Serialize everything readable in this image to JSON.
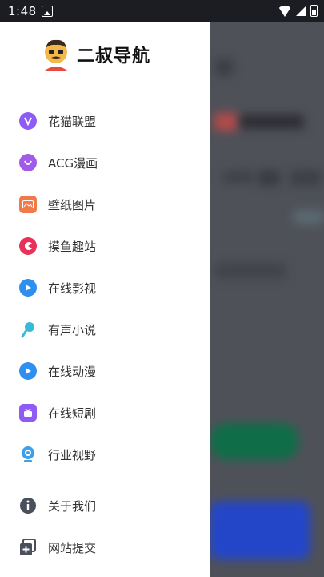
{
  "status_bar": {
    "time": "1:48",
    "icons": [
      "gallery-icon",
      "wifi-icon",
      "signal-icon",
      "battery-icon"
    ]
  },
  "drawer": {
    "title": "二叔导航",
    "menu": [
      {
        "label": "花猫联盟",
        "icon": "cat-league-icon",
        "color": "#8e5cf5"
      },
      {
        "label": "ACG漫画",
        "icon": "smile-icon",
        "color": "#a25be8"
      },
      {
        "label": "壁纸图片",
        "icon": "wallpaper-icon",
        "color": "#f07a4a"
      },
      {
        "label": "摸鱼趣站",
        "icon": "game-icon",
        "color": "#e8325a"
      },
      {
        "label": "在线影视",
        "icon": "play-icon",
        "color": "#2f8ff0"
      },
      {
        "label": "有声小说",
        "icon": "microphone-icon",
        "color": "#39b9d8"
      },
      {
        "label": "在线动漫",
        "icon": "play-icon",
        "color": "#2f8ff0"
      },
      {
        "label": "在线短剧",
        "icon": "tv-icon",
        "color": "#8e5cf5"
      },
      {
        "label": "行业视野",
        "icon": "camera-icon",
        "color": "#3da0e8"
      }
    ],
    "footer": [
      {
        "label": "关于我们",
        "icon": "info-icon"
      },
      {
        "label": "网站提交",
        "icon": "submit-icon"
      }
    ]
  },
  "colors": {
    "status_bar": "#1c1d22",
    "overlay": "#4f5159",
    "text": "#333333"
  }
}
